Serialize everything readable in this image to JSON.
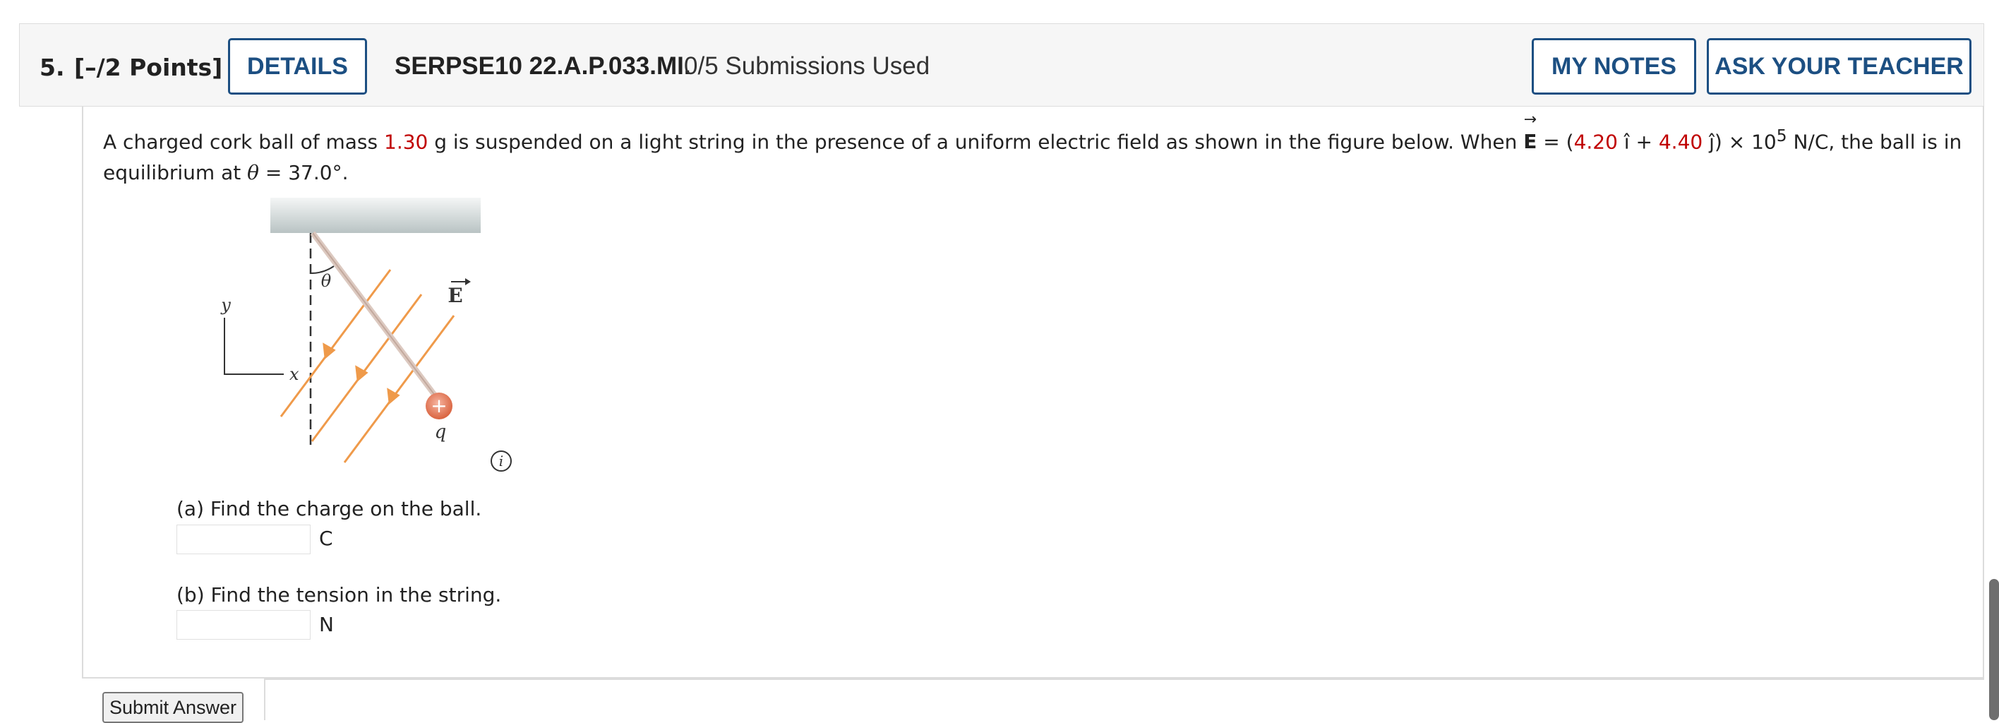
{
  "question": {
    "number": "5.",
    "points": "[–/2 Points]",
    "details_button": "DETAILS",
    "code": "SERPSE10 22.A.P.033.MI.",
    "submissions": "0/5 Submissions Used",
    "my_notes_button": "MY NOTES",
    "ask_teacher_button": "ASK YOUR TEACHER"
  },
  "problem": {
    "text_1": "A charged cork ball of mass ",
    "mass": "1.30",
    "text_2": " g is suspended on a light string in the presence of a uniform electric field as shown in the figure below. When ",
    "e_symbol": "E",
    "e_arrow": "→",
    "text_3": " = (",
    "ex": "4.20",
    "i_hat": " î + ",
    "ey": "4.40",
    "j_hat": " ĵ) × 10",
    "exponent": "5",
    "text_4": " N/C, the ball is in equilibrium at ",
    "theta_symbol": "θ",
    "text_5": " = 37.0°."
  },
  "figure": {
    "y_label": "y",
    "x_label": "x",
    "theta_label": "θ",
    "e_label": "E",
    "charge_label": "q",
    "plus_sign": "+",
    "info_glyph": "i"
  },
  "part_a": {
    "label": "(a) Find the charge on the ball.",
    "unit": "C",
    "value": ""
  },
  "part_b": {
    "label": "(b) Find the tension in the string.",
    "unit": "N",
    "value": ""
  },
  "submit_button": "Submit Answer",
  "colors": {
    "accent_blue": "#1c4f82",
    "value_red": "#c00000",
    "field_orange": "#ef9a4a"
  }
}
